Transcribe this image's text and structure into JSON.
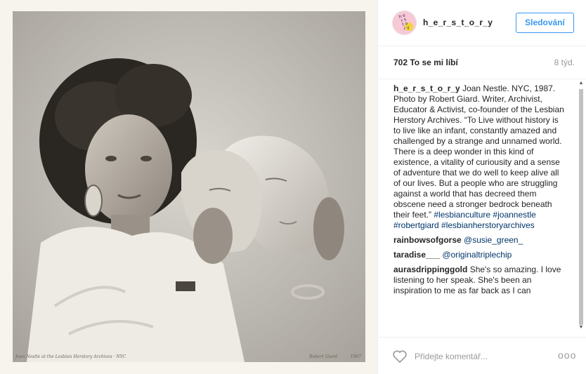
{
  "post": {
    "photo": {
      "caption": "Joan Nestle at the Lesbian Herstory Archives · NYC",
      "signature": "Robert Giard",
      "year": "1987"
    },
    "header": {
      "username": "h_e_r_s_t_o_r_y",
      "follow_label": "Sledování"
    },
    "likes": "702 To se mi líbí",
    "age": "8 týd.",
    "comments": [
      {
        "user": "h_e_r_s_t_o_r_y",
        "text": "Joan Nestle. NYC, 1987. Photo by Robert Giard. Writer, Archivist, Educator & Activist, co-founder of the Lesbian Herstory Archives. “To Live without history is to live like an infant, constantly amazed and challenged by a strange and unnamed world. There is a deep wonder in this kind of existence, a vitality of curiousity and a sense of adventure that we do well to keep alive all of our lives. But a people who are struggling against a world that has decreed them obscene need a stronger bedrock beneath their feet.”",
        "tags": "#lesbianculture #joannestle #robertgiard #lesbianherstoryarchives"
      },
      {
        "user": "rainbowsofgorse",
        "text": "",
        "tags": "@susie_green_"
      },
      {
        "user": "taradise___",
        "text": "",
        "tags": "@originaltriplechip"
      },
      {
        "user": "aurasdrippinggold",
        "text": "She's so amazing. I love listening to her speak. She's been an inspiration to me as far back as I can",
        "tags": ""
      }
    ],
    "comment_placeholder": "Přidejte komentář...",
    "more_label": "ooo",
    "icons": {
      "heart": "heart-outline-icon",
      "more": "more-options-icon",
      "scroll_up": "scroll-up-icon",
      "scroll_down": "scroll-down-icon"
    },
    "colors": {
      "accent": "#3897f0",
      "link": "#003569",
      "muted": "#999999"
    }
  }
}
